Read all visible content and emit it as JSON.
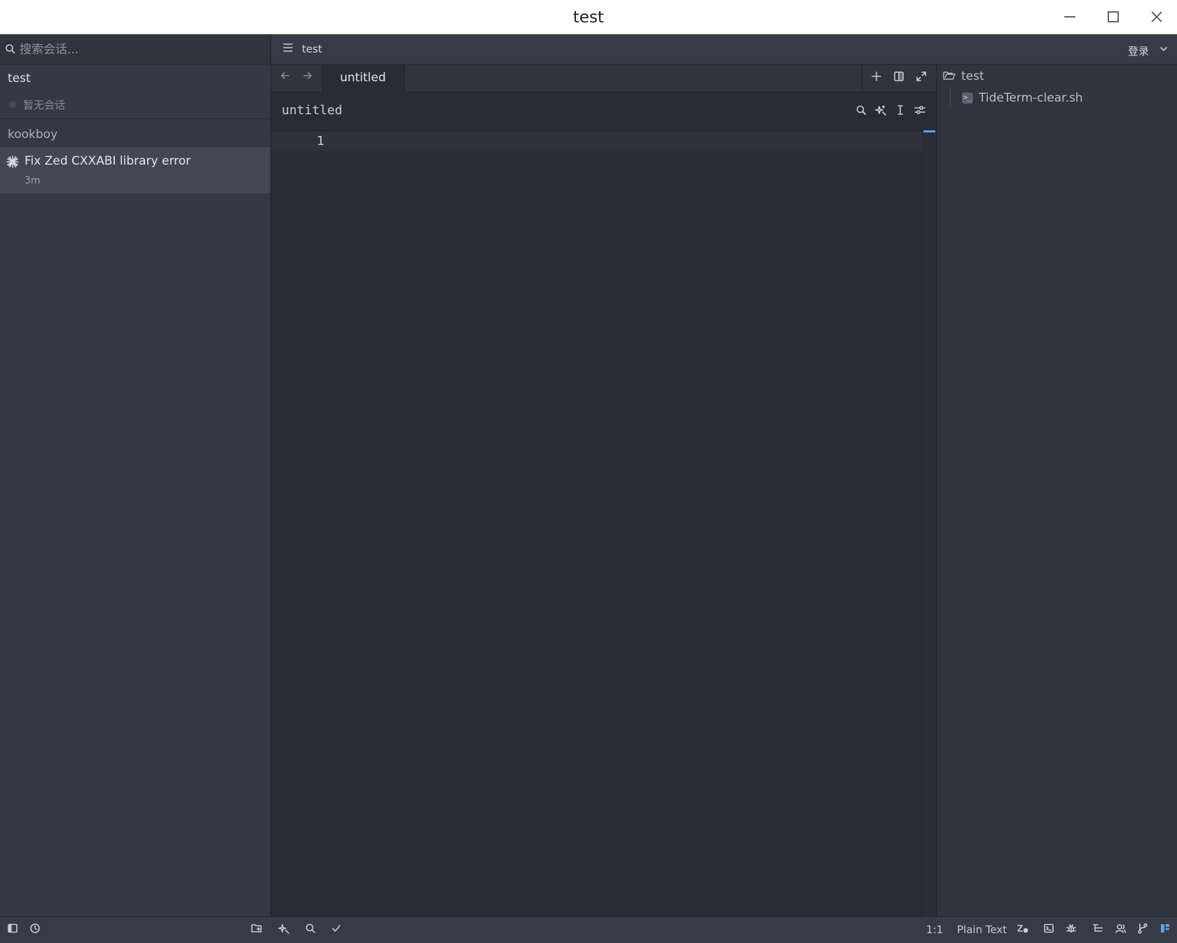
{
  "window": {
    "title": "test"
  },
  "sidebar": {
    "search_placeholder": "搜索会话...",
    "groups": [
      {
        "name": "test",
        "empty_label": "暂无会话"
      },
      {
        "name": "kookboy",
        "items": [
          {
            "title": "Fix Zed CXXABI library error",
            "time": "3m"
          }
        ]
      }
    ]
  },
  "header": {
    "project": "test",
    "login": "登录"
  },
  "tabs": [
    {
      "label": "untitled",
      "active": true
    }
  ],
  "editor": {
    "file_name": "untitled",
    "line_numbers": [
      "1"
    ]
  },
  "project_panel": {
    "root": "test",
    "files": [
      "TideTerm-clear.sh"
    ]
  },
  "statusbar": {
    "cursor": "1:1",
    "language": "Plain Text"
  },
  "colors": {
    "accent": "#5ea0e8",
    "background": "#282c34",
    "sidebar": "#343a45"
  }
}
